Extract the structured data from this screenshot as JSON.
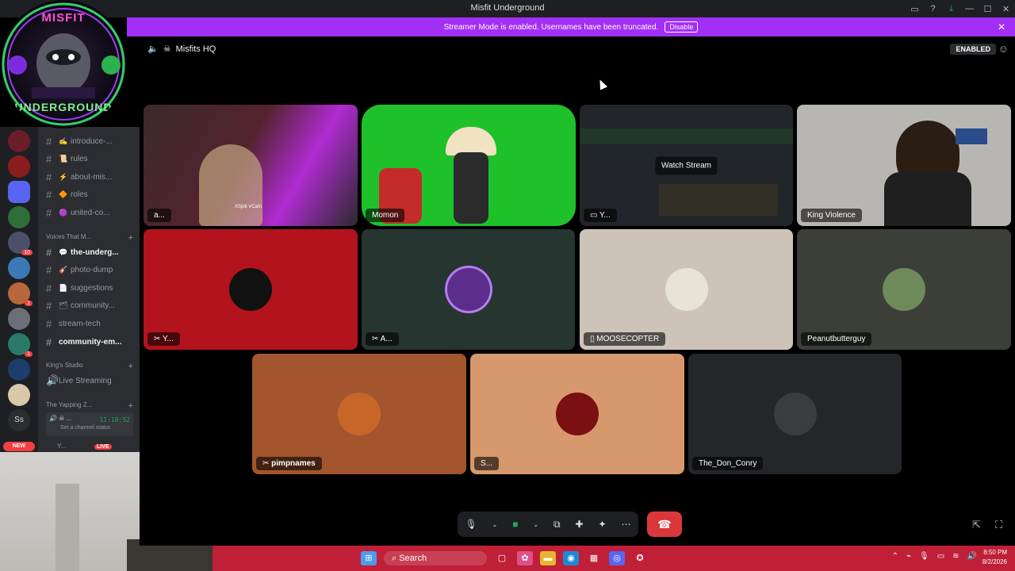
{
  "window": {
    "title": "Misfit Underground"
  },
  "banner": {
    "text": "Streamer Mode is enabled. Usernames have been truncated.",
    "disable": "Disable"
  },
  "header": {
    "channel": "Misfits HQ",
    "enabled": "ENABLED"
  },
  "logo": {
    "text_top": "MISFIT",
    "text_bottom": "UNDERGROUND"
  },
  "channels": [
    {
      "label": "introduce-...",
      "emoji": "✍"
    },
    {
      "label": "rules",
      "emoji": "📜"
    },
    {
      "label": "about-mis...",
      "emoji": "⚡"
    },
    {
      "label": "roles",
      "emoji": "🔶"
    },
    {
      "label": "united-co...",
      "emoji": "🟣"
    }
  ],
  "category1": "Voices That M...",
  "channels2": [
    {
      "label": "the-underg...",
      "emoji": "💬",
      "bright": true
    },
    {
      "label": "photo-dump",
      "emoji": "🎸"
    },
    {
      "label": "suggestions",
      "emoji": "📄"
    },
    {
      "label": "community...",
      "emoji": "🗂"
    },
    {
      "label": "stream-tech",
      "emoji": ""
    },
    {
      "label": "community-em...",
      "emoji": "",
      "bright": true
    }
  ],
  "category2": "King's Studio",
  "live_streaming": "Live Streaming",
  "category3": "The Yapping Z...",
  "voice_status": {
    "name": "...",
    "time": "11:18:52",
    "sub": "Set a channel status"
  },
  "live_user": {
    "name": "Y...",
    "badge": "LIVE"
  },
  "servers_badges": {
    "b1": "10",
    "b2": "1",
    "b3": "1",
    "new": "NEW",
    "ss": "Ss"
  },
  "tiles": [
    {
      "name": "a...",
      "bg": "#3a2a2a"
    },
    {
      "name": "Momon",
      "bg": "#1fc12b"
    },
    {
      "name": "Y...",
      "bg": "#22252a",
      "watch": "Watch Stream"
    },
    {
      "name": "King Violence",
      "bg": "#b8b6b2"
    },
    {
      "name": "Y...",
      "bg": "#b3131c"
    },
    {
      "name": "A...",
      "bg": "#263530"
    },
    {
      "name": "MOOSECOPTER",
      "bg": "#cdc3b8"
    },
    {
      "name": "Peanutbutterguy",
      "bg": "#3b3f38"
    },
    {
      "name": "pimpnames",
      "bg": "#a3552d"
    },
    {
      "name": "S...",
      "bg": "#d6986c"
    },
    {
      "name": "The_Don_Conry",
      "bg": "#24262a"
    }
  ],
  "tile_extra": {
    "cam_label": "XSplit VCam"
  },
  "taskbar": {
    "search": "Search",
    "time": "8:50 PM",
    "date": "8/2/2026"
  },
  "icons": [
    "speaker-icon",
    "skull-icon",
    "mic-icon",
    "camera-icon",
    "screenshare-icon",
    "activities-icon",
    "soundboard-icon",
    "more-icon",
    "hangup-icon",
    "popout-icon",
    "fullscreen-icon"
  ]
}
